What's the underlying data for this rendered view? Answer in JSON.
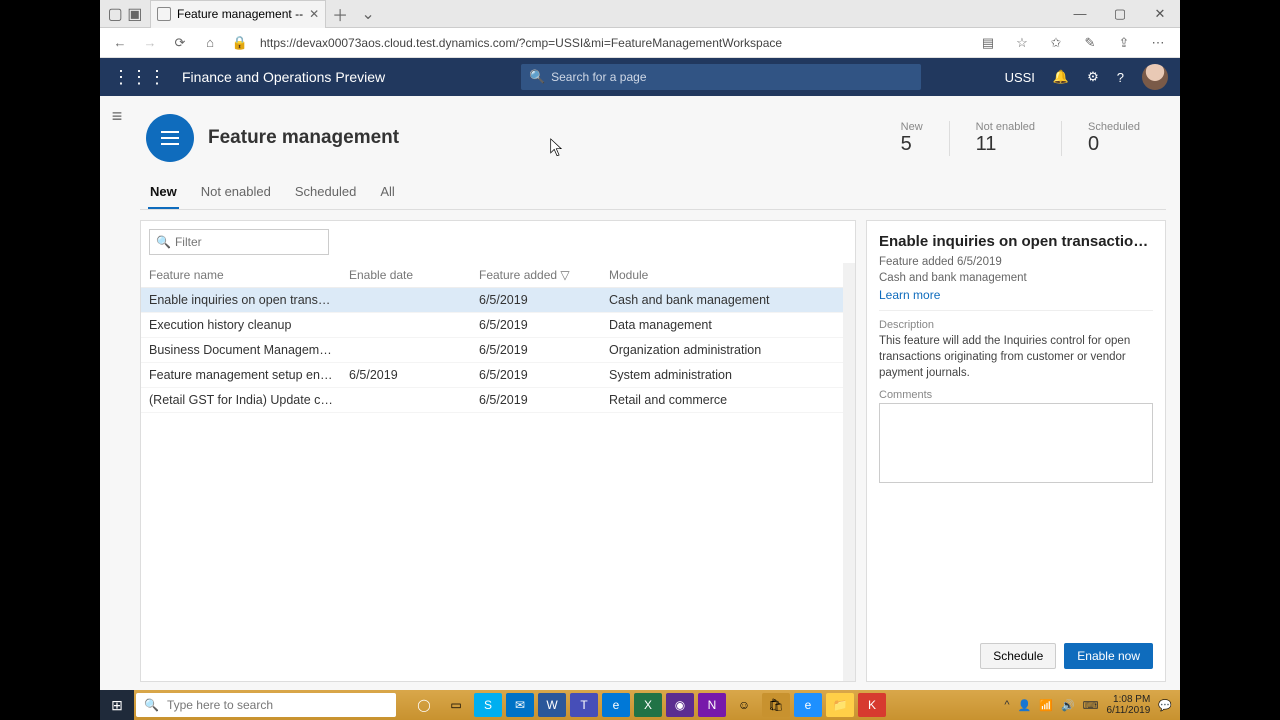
{
  "browser": {
    "tab_title": "Feature management --",
    "url": "https://devax00073aos.cloud.test.dynamics.com/?cmp=USSI&mi=FeatureManagementWorkspace"
  },
  "topnav": {
    "brand": "Finance and Operations Preview",
    "search_placeholder": "Search for a page",
    "company": "USSI"
  },
  "page": {
    "title": "Feature management",
    "stats": [
      {
        "label": "New",
        "value": "5"
      },
      {
        "label": "Not enabled",
        "value": "11"
      },
      {
        "label": "Scheduled",
        "value": "0"
      }
    ],
    "tabs": [
      "New",
      "Not enabled",
      "Scheduled",
      "All"
    ],
    "active_tab": 0,
    "filter_placeholder": "Filter",
    "columns": {
      "name": "Feature name",
      "enable": "Enable date",
      "added": "Feature added",
      "module": "Module"
    },
    "rows": [
      {
        "name": "Enable inquiries on open transa...",
        "enable": "",
        "added": "6/5/2019",
        "module": "Cash and bank management",
        "locked": false,
        "selected": true
      },
      {
        "name": "Execution history cleanup",
        "enable": "",
        "added": "6/5/2019",
        "module": "Data management",
        "locked": false
      },
      {
        "name": "Business Document Management",
        "enable": "",
        "added": "6/5/2019",
        "module": "Organization administration",
        "locked": false
      },
      {
        "name": "Feature management setup enh...",
        "enable": "6/5/2019",
        "added": "6/5/2019",
        "module": "System administration",
        "locked": true
      },
      {
        "name": "(Retail GST for India) Update cre...",
        "enable": "",
        "added": "6/5/2019",
        "module": "Retail and commerce",
        "locked": false
      }
    ]
  },
  "detail": {
    "title": "Enable inquiries on open transactions ...",
    "added_line": "Feature added 6/5/2019",
    "module": "Cash and bank management",
    "learn_more": "Learn more",
    "desc_label": "Description",
    "description": "This feature will add the Inquiries control for open transactions originating from customer or vendor payment journals.",
    "comments_label": "Comments",
    "schedule_btn": "Schedule",
    "enable_btn": "Enable now"
  },
  "taskbar": {
    "search_placeholder": "Type here to search",
    "time": "1:08 PM",
    "date": "6/11/2019"
  }
}
